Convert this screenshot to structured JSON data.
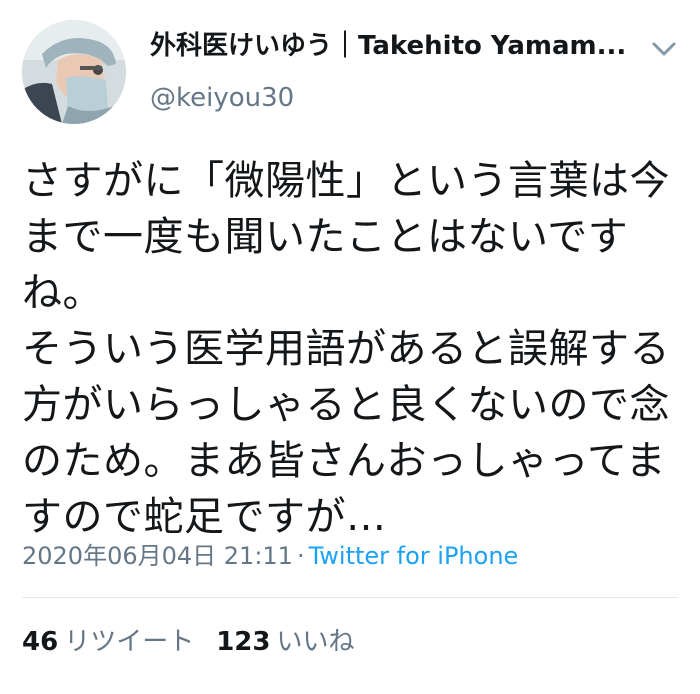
{
  "author": {
    "display_name": "外科医けいゆう｜Takehito Yamam...",
    "handle": "@keiyou30",
    "avatar_icon": "surgeon-avatar"
  },
  "menu_icon": "chevron-down-icon",
  "tweet": {
    "text": "さすがに「微陽性」という言葉は今まで一度も聞いたことはないですね。\nそういう医学用語があると誤解する方がいらっしゃると良くないので念のため。まあ皆さんおっしゃってますので蛇足ですが…",
    "timestamp": "2020年06月04日 21:11",
    "separator": "·",
    "source": "Twitter for iPhone"
  },
  "stats": {
    "retweets_count": "46",
    "retweets_label": "リツイート",
    "likes_count": "123",
    "likes_label": "いいね"
  },
  "colors": {
    "text": "#14171a",
    "secondary": "#657786",
    "link": "#1da1f2",
    "divider": "#e1e8ed"
  }
}
